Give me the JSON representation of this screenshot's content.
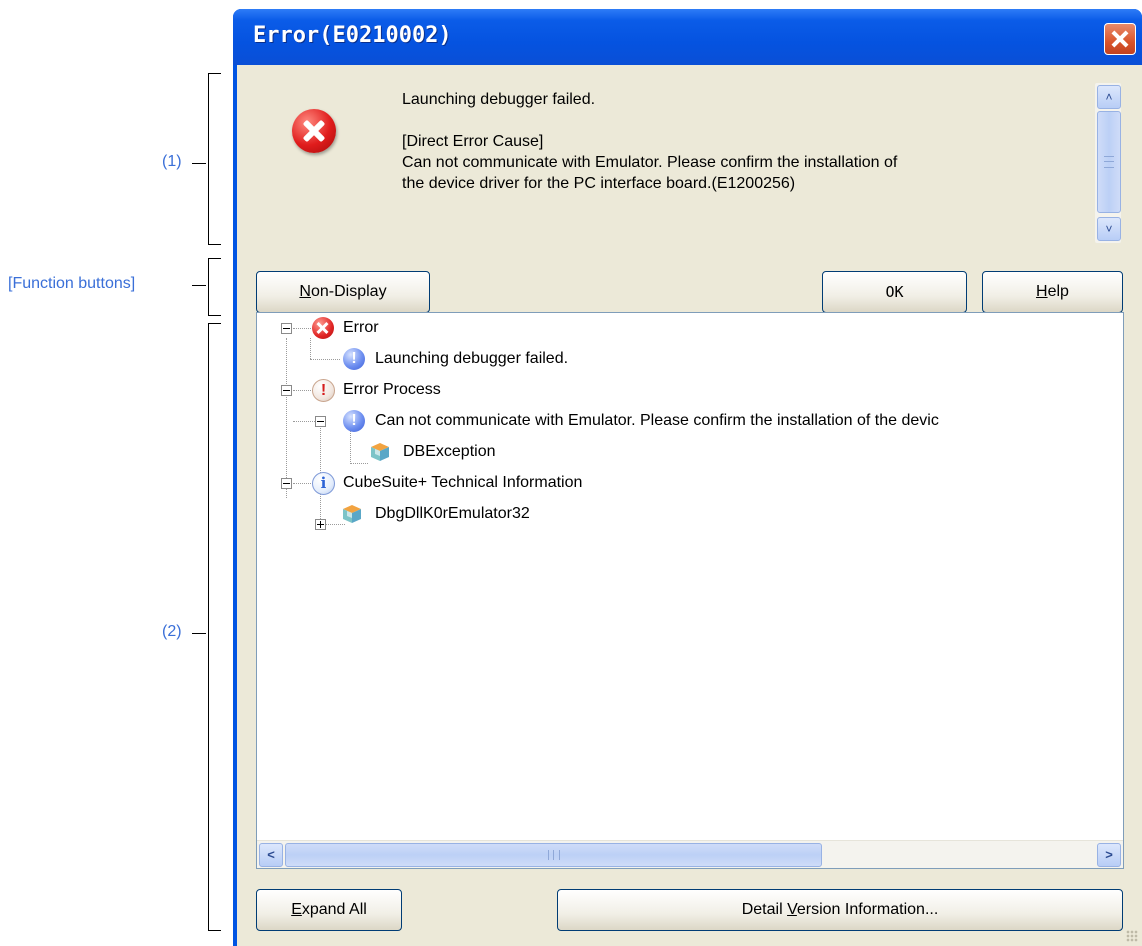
{
  "annotations": {
    "label_1": "(1)",
    "label_function_buttons": "[Function buttons]",
    "label_2": "(2)"
  },
  "window": {
    "title": "Error(E0210002)"
  },
  "message": {
    "line1": "Launching debugger failed.",
    "line2": "[Direct Error Cause]",
    "line3": "Can not communicate with Emulator. Please confirm the installation of",
    "line4": "the device driver for the PC interface board.(E1200256)"
  },
  "buttons": {
    "non_display_mnemonic": "N",
    "non_display_rest": "on-Display",
    "ok": "OK",
    "help_mnemonic": "H",
    "help_rest": "elp",
    "expand_all_mnemonic": "E",
    "expand_all_rest": "xpand All",
    "detail_pre": "Detail ",
    "detail_mnemonic": "V",
    "detail_rest": "ersion Information..."
  },
  "tree": {
    "error": "Error",
    "error_child": "Launching debugger failed.",
    "error_process": "Error Process",
    "error_process_child": "Can not communicate with Emulator. Please confirm the installation of the devic",
    "exception": "DBException",
    "tech_info": "CubeSuite+ Technical Information",
    "tech_child": "DbgDllK0rEmulator32"
  },
  "scrollbar": {
    "thumb_grip": "III"
  },
  "colors": {
    "title_bar": "#0054e3",
    "client_bg": "#ece9d8",
    "annotation_text": "#3a6fd8"
  }
}
